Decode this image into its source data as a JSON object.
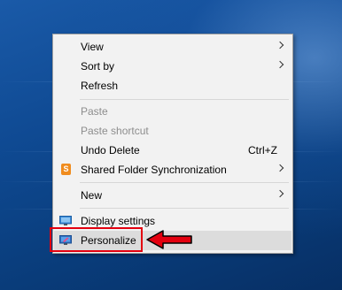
{
  "context_menu": {
    "items": [
      {
        "label": "View",
        "submenu": true
      },
      {
        "label": "Sort by",
        "submenu": true
      },
      {
        "label": "Refresh"
      },
      {
        "label": "Paste",
        "disabled": true
      },
      {
        "label": "Paste shortcut",
        "disabled": true
      },
      {
        "label": "Undo Delete",
        "shortcut": "Ctrl+Z"
      },
      {
        "label": "Shared Folder Synchronization",
        "submenu": true,
        "icon": "sync-icon"
      },
      {
        "label": "New",
        "submenu": true
      },
      {
        "label": "Display settings",
        "icon": "display-icon"
      },
      {
        "label": "Personalize",
        "icon": "personalize-icon",
        "highlighted": true
      }
    ]
  },
  "annotation": {
    "highlight_color": "#e3000f",
    "target_item": "Personalize"
  },
  "colors": {
    "menu_background": "#f2f2f2",
    "hover": "#dcdcdc",
    "disabled_text": "#8d8d8d"
  }
}
